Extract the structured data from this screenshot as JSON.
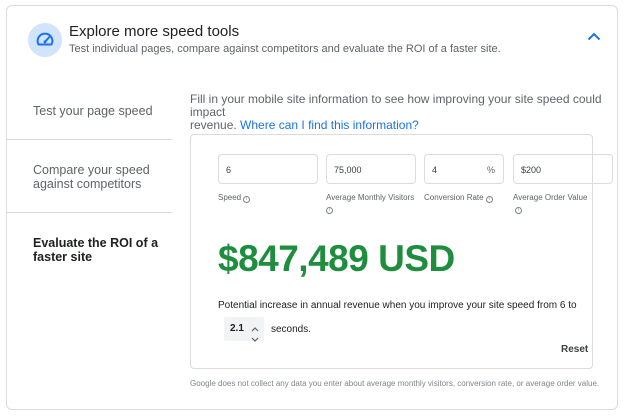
{
  "header": {
    "title": "Explore more speed tools",
    "subtitle": "Test individual pages, compare against competitors and evaluate the ROI of a faster site.",
    "icon": "speedometer-icon",
    "toggle_icon": "chevron-up-icon"
  },
  "sidebar": {
    "items": [
      {
        "label_lines": [
          "Test your page speed"
        ],
        "active": false
      },
      {
        "label_lines": [
          "Compare your speed",
          "against competitors"
        ],
        "active": false
      },
      {
        "label_lines": [
          "Evaluate the ROI of a",
          "faster site"
        ],
        "active": true
      }
    ]
  },
  "intro": {
    "line1": "Fill in your mobile site information to see how improving your site speed could impact",
    "line2_prefix": "revenue.",
    "link": "Where can I find this information?"
  },
  "form": {
    "speed": {
      "value": "6",
      "label": "Speed"
    },
    "visitors": {
      "value": "75,000",
      "label_line1": "Average Monthly Visitors"
    },
    "conversion": {
      "value": "4",
      "unit": "%",
      "label": "Conversion Rate"
    },
    "order_value": {
      "value": "$200",
      "label": "Average Order Value"
    }
  },
  "result": {
    "amount": "$847,489 USD",
    "description": "Potential increase in annual revenue when you improve your site speed from 6 to",
    "target_seconds": "2.1",
    "seconds_label": "seconds.",
    "reset_label": "Reset"
  },
  "disclaimer": "Google does not collect any data you enter about average monthly visitors, conversion rate, or average order value.",
  "colors": {
    "accent": "#1a73e8",
    "result_green": "#1e8e3e",
    "icon_bg": "#d2e3fc"
  }
}
